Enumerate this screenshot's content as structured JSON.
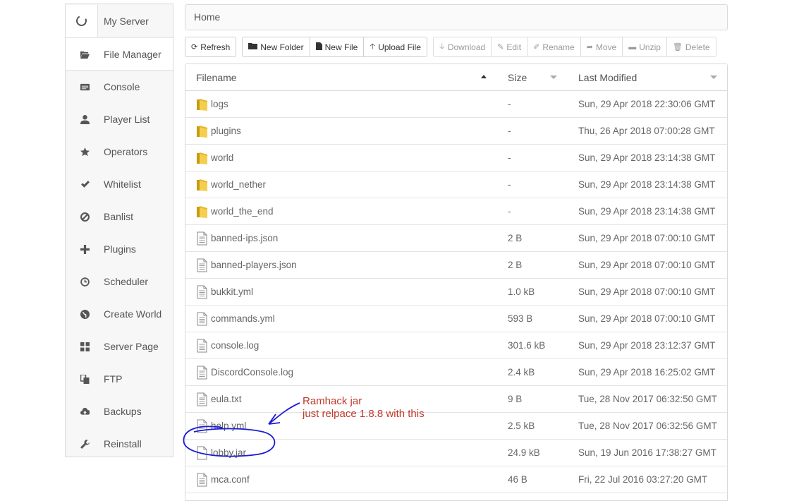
{
  "sidebar": {
    "server_label": "My Server",
    "items": [
      {
        "label": "File Manager",
        "icon": "folder-open-icon"
      },
      {
        "label": "Console",
        "icon": "console-icon"
      },
      {
        "label": "Player List",
        "icon": "user-icon"
      },
      {
        "label": "Operators",
        "icon": "star-icon"
      },
      {
        "label": "Whitelist",
        "icon": "check-icon"
      },
      {
        "label": "Banlist",
        "icon": "ban-icon"
      },
      {
        "label": "Plugins",
        "icon": "plus-icon"
      },
      {
        "label": "Scheduler",
        "icon": "clock-icon"
      },
      {
        "label": "Create World",
        "icon": "globe-icon"
      },
      {
        "label": "Server Page",
        "icon": "grid-icon"
      },
      {
        "label": "FTP",
        "icon": "copy-icon"
      },
      {
        "label": "Backups",
        "icon": "cloud-upload-icon"
      },
      {
        "label": "Reinstall",
        "icon": "wrench-icon"
      }
    ]
  },
  "breadcrumb": "Home",
  "toolbar": {
    "refresh": "Refresh",
    "new_folder": "New Folder",
    "new_file": "New File",
    "upload_file": "Upload File",
    "download": "Download",
    "edit": "Edit",
    "rename": "Rename",
    "move": "Move",
    "unzip": "Unzip",
    "delete": "Delete"
  },
  "table": {
    "headers": {
      "name": "Filename",
      "size": "Size",
      "modified": "Last Modified"
    },
    "rows": [
      {
        "type": "folder",
        "name": "logs",
        "size": "-",
        "modified": "Sun, 29 Apr 2018 22:30:06 GMT"
      },
      {
        "type": "folder",
        "name": "plugins",
        "size": "-",
        "modified": "Thu, 26 Apr 2018 07:00:28 GMT"
      },
      {
        "type": "folder",
        "name": "world",
        "size": "-",
        "modified": "Sun, 29 Apr 2018 23:14:38 GMT"
      },
      {
        "type": "folder",
        "name": "world_nether",
        "size": "-",
        "modified": "Sun, 29 Apr 2018 23:14:38 GMT"
      },
      {
        "type": "folder",
        "name": "world_the_end",
        "size": "-",
        "modified": "Sun, 29 Apr 2018 23:14:38 GMT"
      },
      {
        "type": "text",
        "name": "banned-ips.json",
        "size": "2 B",
        "modified": "Sun, 29 Apr 2018 07:00:10 GMT"
      },
      {
        "type": "text",
        "name": "banned-players.json",
        "size": "2 B",
        "modified": "Sun, 29 Apr 2018 07:00:10 GMT"
      },
      {
        "type": "text",
        "name": "bukkit.yml",
        "size": "1.0 kB",
        "modified": "Sun, 29 Apr 2018 07:00:10 GMT"
      },
      {
        "type": "text",
        "name": "commands.yml",
        "size": "593 B",
        "modified": "Sun, 29 Apr 2018 07:00:10 GMT"
      },
      {
        "type": "text",
        "name": "console.log",
        "size": "301.6 kB",
        "modified": "Sun, 29 Apr 2018 23:12:37 GMT"
      },
      {
        "type": "text",
        "name": "DiscordConsole.log",
        "size": "2.4 kB",
        "modified": "Sun, 29 Apr 2018 16:25:02 GMT"
      },
      {
        "type": "text",
        "name": "eula.txt",
        "size": "9 B",
        "modified": "Tue, 28 Nov 2017 06:32:50 GMT"
      },
      {
        "type": "text",
        "name": "help.yml",
        "size": "2.5 kB",
        "modified": "Tue, 28 Nov 2017 06:32:56 GMT"
      },
      {
        "type": "blank",
        "name": "lobby.jar",
        "size": "24.9 kB",
        "modified": "Sun, 19 Jun 2016 17:38:27 GMT"
      },
      {
        "type": "text",
        "name": "mca.conf",
        "size": "46 B",
        "modified": "Fri, 22 Jul 2016 03:27:20 GMT"
      }
    ]
  },
  "annotation": {
    "line1": "Ramhack jar",
    "line2": "just relpace 1.8.8 with this",
    "color": "#c0392b"
  },
  "colors": {
    "scribble": "#1a1ad6",
    "folder": "#e6b422"
  }
}
